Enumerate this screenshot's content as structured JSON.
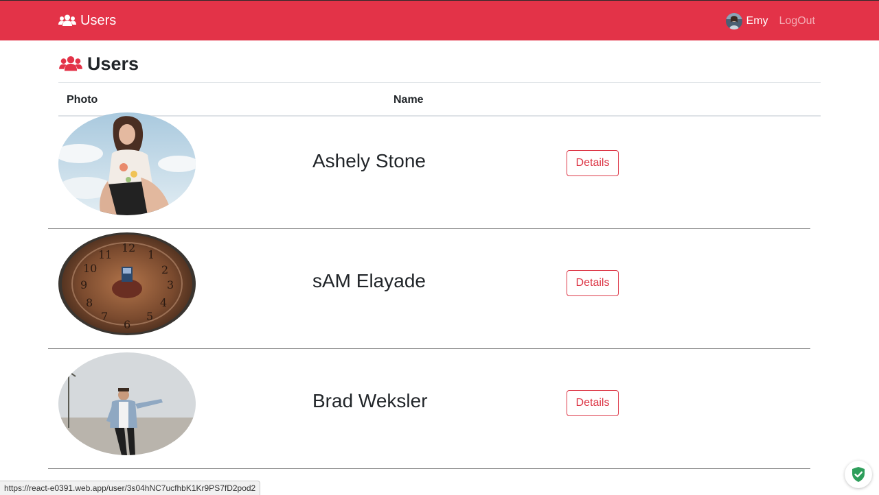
{
  "navbar": {
    "brand_label": "Users",
    "user_name": "Emy",
    "logout_label": "LogOut"
  },
  "page": {
    "title": "Users"
  },
  "table": {
    "headers": [
      "Photo",
      "Name"
    ],
    "rows": [
      {
        "name": "Ashely Stone",
        "action": "Details"
      },
      {
        "name": "sAM Elayade",
        "action": "Details"
      },
      {
        "name": "Brad Weksler",
        "action": "Details"
      }
    ]
  },
  "status_bar": {
    "url": "https://react-e0391.web.app/user/3s04hNC7ucfhbK1Kr9PS7fD2pod2"
  },
  "icons": {
    "brand": "users-icon",
    "title": "users-icon",
    "badge": "shield-check-icon"
  },
  "colors": {
    "navbar": "#e33348",
    "accent": "#dc3545",
    "title_icon": "#e33348",
    "badge": "#2e9e5b"
  }
}
